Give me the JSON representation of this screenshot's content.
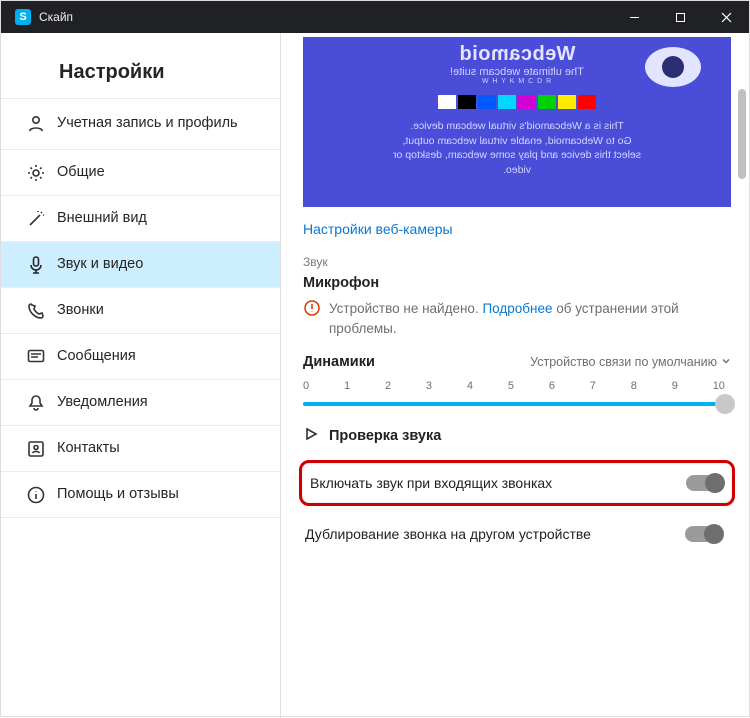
{
  "titlebar": {
    "app_name": "Скайп"
  },
  "sidebar": {
    "heading": "Настройки",
    "items": [
      {
        "label": "Учетная запись и профиль"
      },
      {
        "label": "Общие"
      },
      {
        "label": "Внешний вид"
      },
      {
        "label": "Звук и видео"
      },
      {
        "label": "Звонки"
      },
      {
        "label": "Сообщения"
      },
      {
        "label": "Уведомления"
      },
      {
        "label": "Контакты"
      },
      {
        "label": "Помощь и отзывы"
      }
    ]
  },
  "webcam_preview": {
    "logo": "Webcamoid",
    "subtitle": "The ultimate webcam suite!",
    "swatches": [
      "#ffffff",
      "#000000",
      "#0058ff",
      "#00d8ff",
      "#d400d4",
      "#00d100",
      "#ffea00",
      "#ff0000"
    ],
    "letters": "W H Y K M C D R",
    "body": "This is a Webcamoid's virtual webcam device.\nGo to Webcamoid, enable virtual webcam output,\nselect this device and play some webcam, desktop or\nvideo."
  },
  "main": {
    "camera_link": "Настройки веб-камеры",
    "sound_section_label": "Звук",
    "mic_title": "Микрофон",
    "mic_warning_prefix": "Устройство не найдено. ",
    "mic_warning_link": "Подробнее",
    "mic_warning_suffix": " об устранении этой проблемы.",
    "speakers_title": "Динамики",
    "speakers_device": "Устройство связи по умолчанию",
    "slider_ticks": [
      "0",
      "1",
      "2",
      "3",
      "4",
      "5",
      "6",
      "7",
      "8",
      "9",
      "10"
    ],
    "slider_value": 10,
    "test_sound": "Проверка звука",
    "toggle1_label": "Включать звук при входящих звонках",
    "toggle2_label": "Дублирование звонка на другом устройстве"
  }
}
